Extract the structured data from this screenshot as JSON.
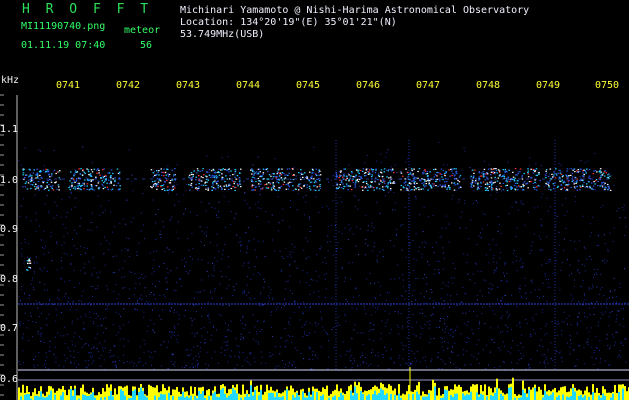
{
  "header": {
    "brand": "H R O F F T",
    "filename": "MI11190740.png",
    "datetime": "01.11.19 07:40",
    "meteor_label": "meteor",
    "meteor_count": "56",
    "observer": "Michinari Yamamoto @ Nishi-Harima Astronomical Observatory",
    "location": "Location: 134°20'19\"(E) 35°01'21\"(N)",
    "frequency": "53.749MHz(USB)"
  },
  "axes": {
    "unit_label": "kHz",
    "time_ticks": [
      "0741",
      "0742",
      "0743",
      "0744",
      "0745",
      "0746",
      "0747",
      "0748",
      "0749",
      "0750"
    ],
    "freq_ticks": [
      "1.1",
      "1.0",
      "0.9",
      "0.8",
      "0.7",
      "0.6"
    ]
  },
  "colors": {
    "background": "#000000",
    "carrier": "#ffff00",
    "signal_hot": "#ff3030",
    "signal_mid": "#22ccff",
    "noise": "#1a2a9a"
  }
}
